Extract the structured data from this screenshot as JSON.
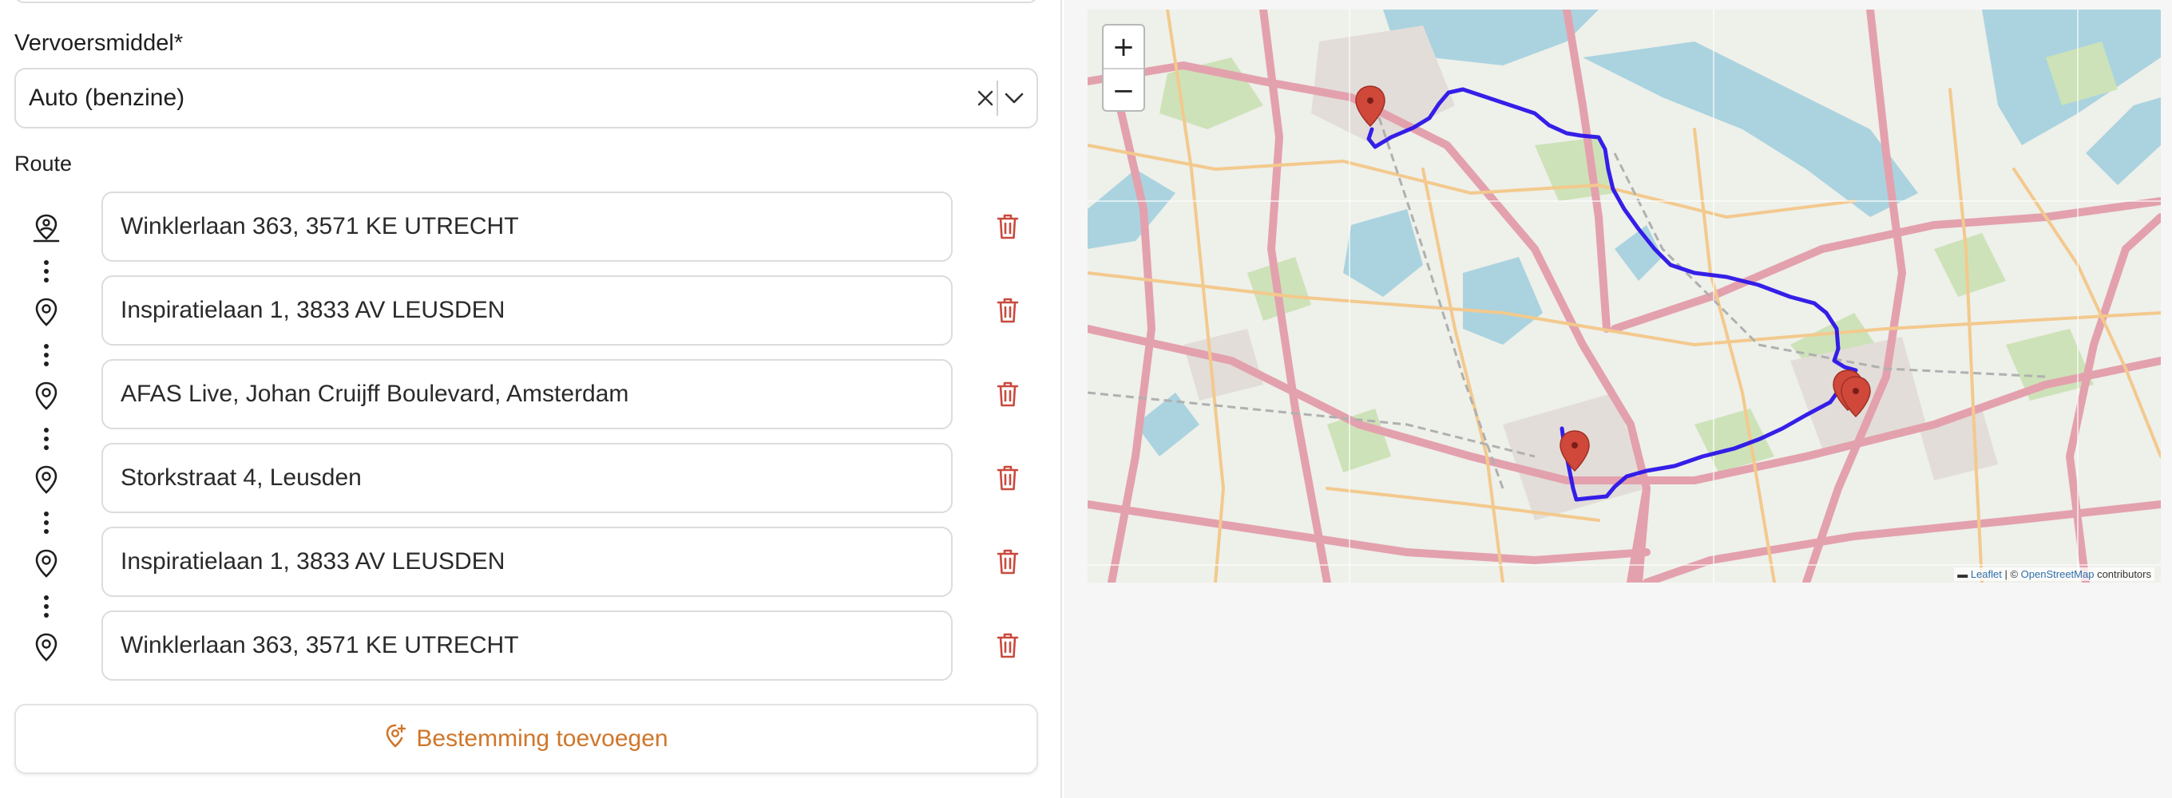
{
  "form": {
    "vehicle_label": "Vervoersmiddel*",
    "vehicle_value": "Auto (benzine)",
    "route_label": "Route",
    "stops": [
      {
        "address": "Winklerlaan 363, 3571 KE UTRECHT",
        "icon": "map-pin-user-icon"
      },
      {
        "address": "Inspiratielaan 1, 3833 AV LEUSDEN",
        "icon": "map-pin-icon"
      },
      {
        "address": "AFAS Live, Johan Cruijff Boulevard, Amsterdam",
        "icon": "map-pin-icon"
      },
      {
        "address": "Storkstraat 4, Leusden",
        "icon": "map-pin-icon"
      },
      {
        "address": "Inspiratielaan 1, 3833 AV LEUSDEN",
        "icon": "map-pin-icon"
      },
      {
        "address": "Winklerlaan 363, 3571 KE UTRECHT",
        "icon": "map-pin-icon"
      }
    ],
    "add_destination_label": "Bestemming toevoegen"
  },
  "map": {
    "zoom_in_label": "+",
    "zoom_out_label": "−",
    "attribution_leaflet": "Leaflet",
    "attribution_sep": " | © ",
    "attribution_osm": "OpenStreetMap",
    "attribution_suffix": " contributors",
    "route_color": "#2a13e8",
    "marker_color": "#d0483a"
  },
  "colors": {
    "accent": "#d0762a",
    "delete": "#c94a3d"
  }
}
